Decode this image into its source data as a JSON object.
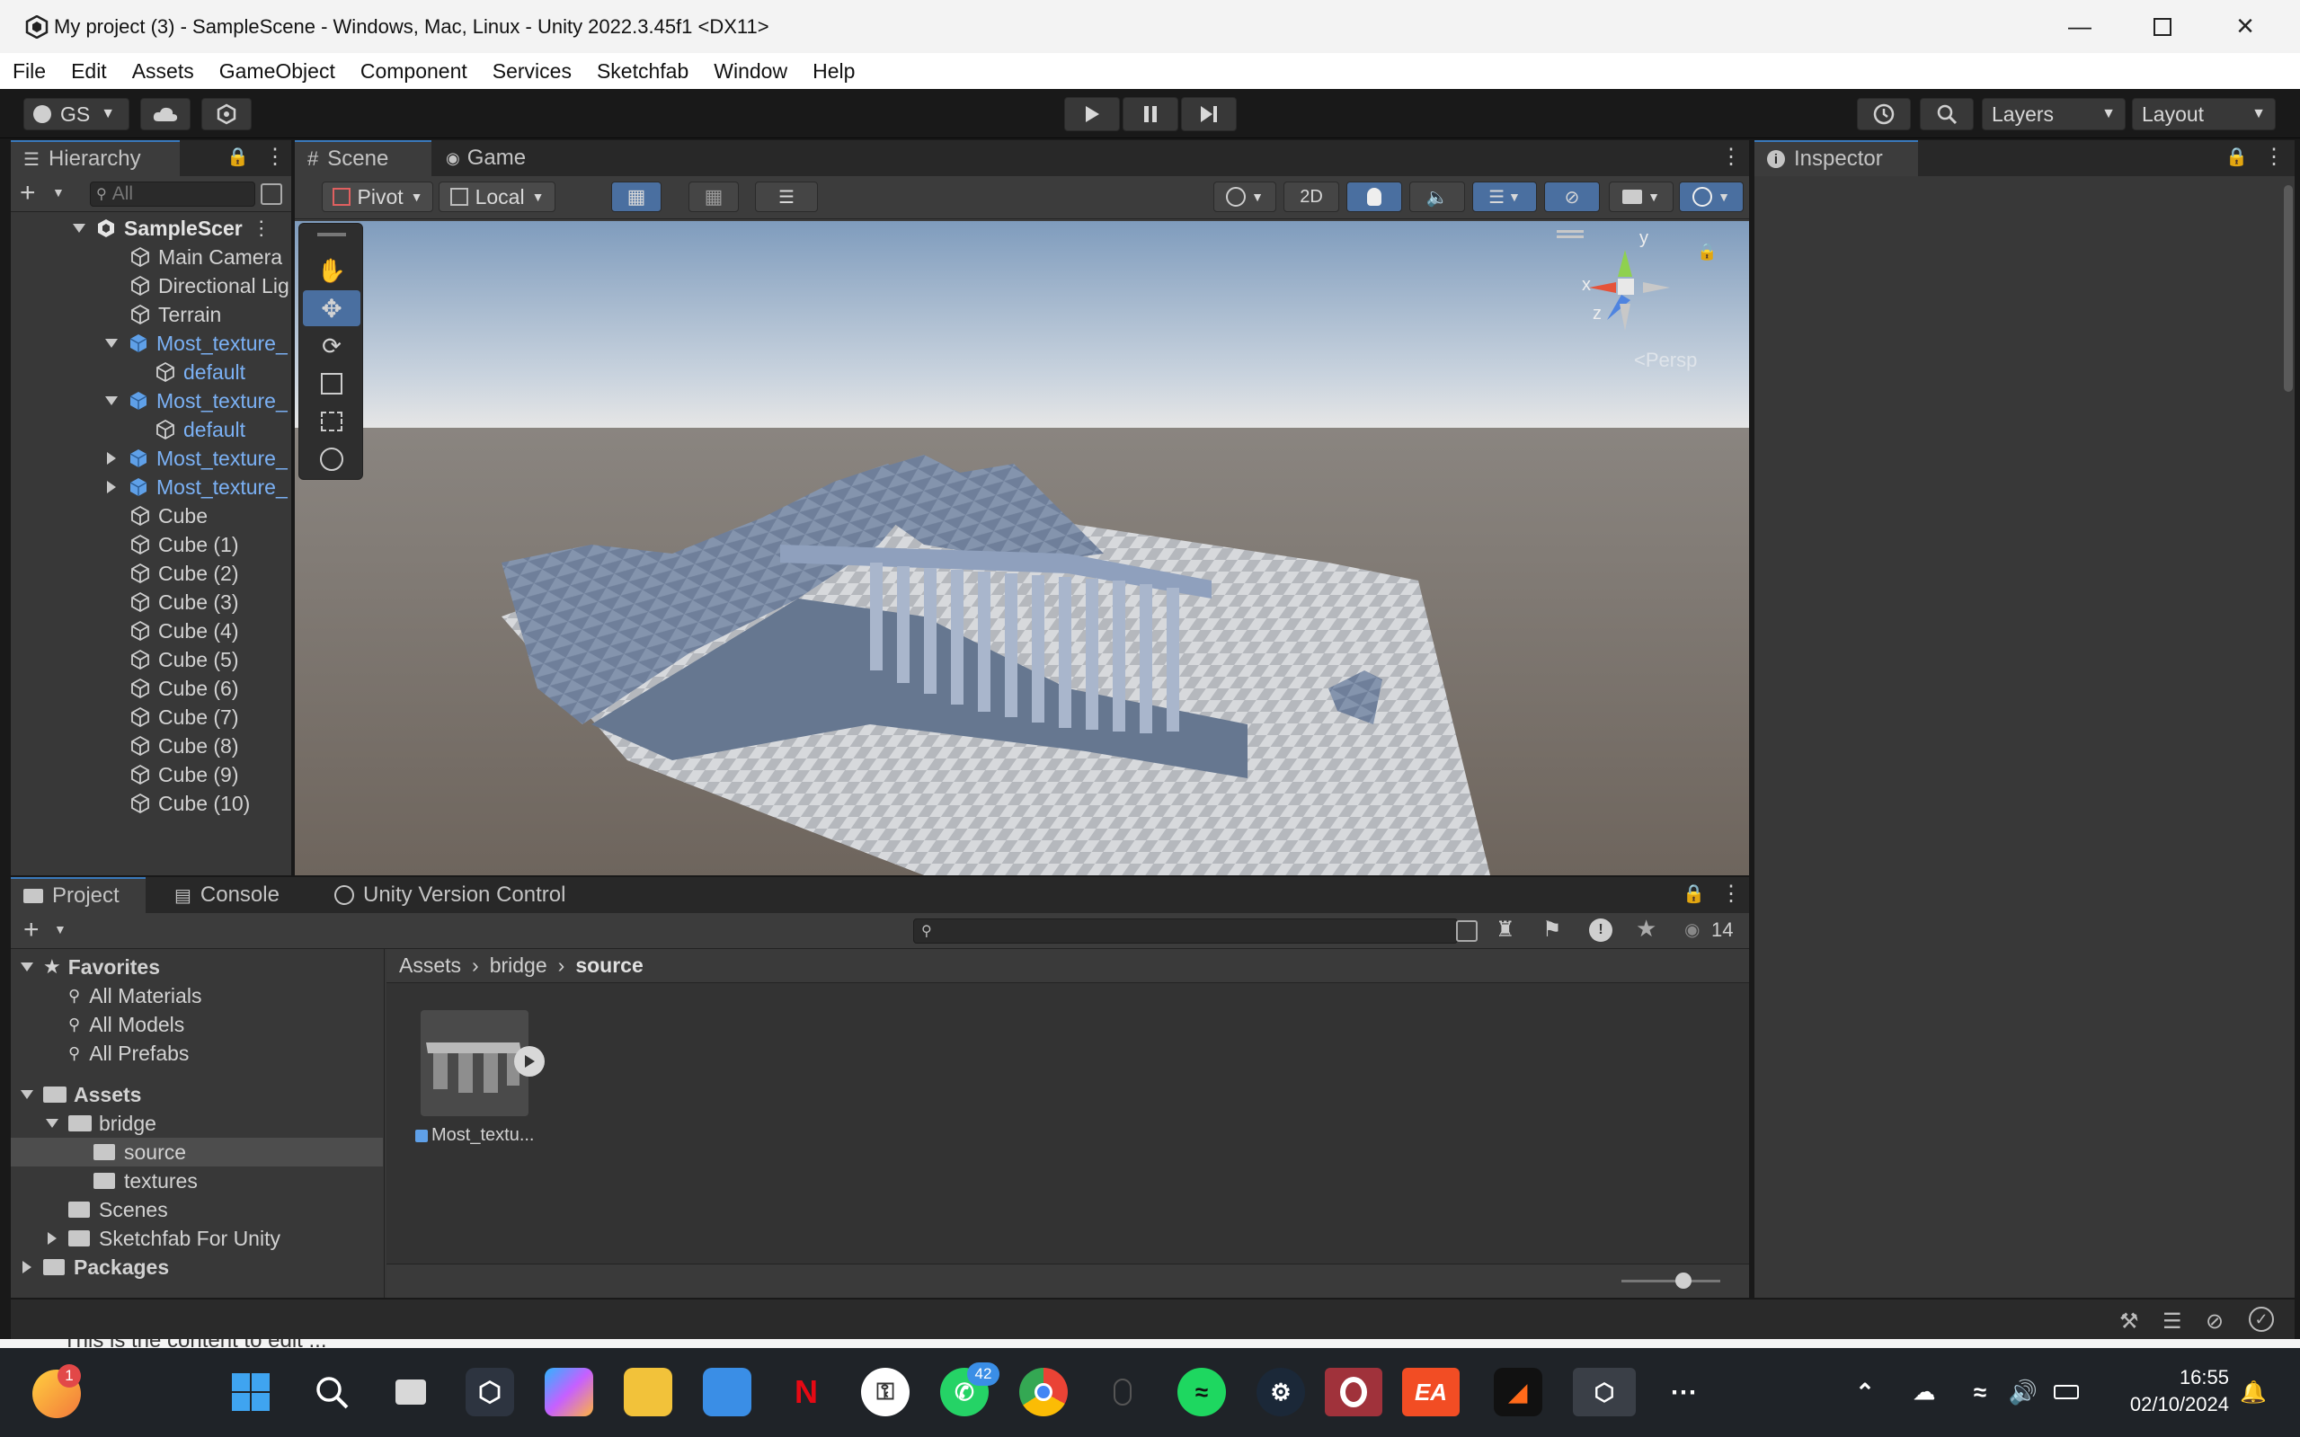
{
  "window": {
    "title": "My project (3) - SampleScene - Windows, Mac, Linux - Unity 2022.3.45f1 <DX11>"
  },
  "menu": [
    "File",
    "Edit",
    "Assets",
    "GameObject",
    "Component",
    "Services",
    "Sketchfab",
    "Window",
    "Help"
  ],
  "toolbar": {
    "account": "GS",
    "layers": "Layers",
    "layout": "Layout"
  },
  "hierarchy": {
    "tab": "Hierarchy",
    "search_placeholder": "All",
    "scene": "SampleScer",
    "items": [
      "Main Camera",
      "Directional Lig",
      "Terrain",
      "Most_texture_",
      "default",
      "Most_texture_",
      "default",
      "Most_texture_",
      "Most_texture_",
      "Cube",
      "Cube (1)",
      "Cube (2)",
      "Cube (3)",
      "Cube (4)",
      "Cube (5)",
      "Cube (6)",
      "Cube (7)",
      "Cube (8)",
      "Cube (9)",
      "Cube (10)"
    ]
  },
  "scene": {
    "tab_scene": "Scene",
    "tab_game": "Game",
    "pivot": "Pivot",
    "local": "Local",
    "mode2d": "2D",
    "persp": "<Persp",
    "gizmo": {
      "y": "y",
      "x": "x",
      "z": "z"
    }
  },
  "inspector": {
    "tab": "Inspector"
  },
  "project": {
    "tab_project": "Project",
    "tab_console": "Console",
    "tab_vc": "Unity Version Control",
    "hidden_count": "14",
    "favorites": {
      "label": "Favorites",
      "items": [
        "All Materials",
        "All Models",
        "All Prefabs"
      ]
    },
    "tree": {
      "assets": "Assets",
      "bridge": "bridge",
      "source": "source",
      "textures": "textures",
      "scenes": "Scenes",
      "sketchfab": "Sketchfab For Unity",
      "packages": "Packages"
    },
    "breadcrumb": [
      "Assets",
      "bridge",
      "source"
    ],
    "asset_name": "Most_textu..."
  },
  "status": {
    "text": "This is the content to edit ..."
  },
  "taskbar": {
    "whatsapp_badge": "42",
    "notif_badge": "1",
    "time": "16:55",
    "date": "02/10/2024"
  }
}
